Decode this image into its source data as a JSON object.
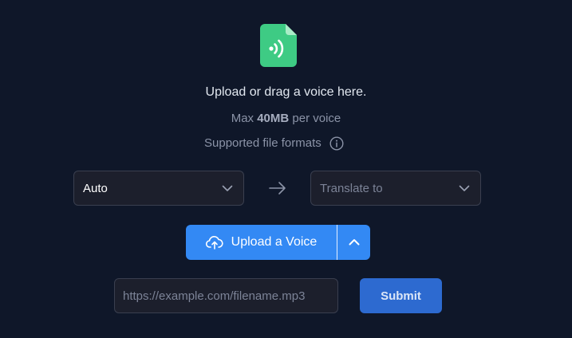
{
  "upload_area": {
    "file_icon": "audio-file-icon",
    "headline": "Upload or drag a voice here.",
    "limit_prefix": "Max ",
    "limit_size": "40MB",
    "limit_suffix": " per voice",
    "formats_label": "Supported file formats",
    "formats_icon": "info-icon"
  },
  "languages": {
    "source_value": "Auto",
    "target_placeholder": "Translate to",
    "arrow_icon": "arrow-right-icon",
    "chevron_icon": "chevron-down-icon"
  },
  "upload_button": {
    "label": "Upload a Voice",
    "icon": "cloud-upload-icon",
    "toggle_icon": "chevron-up-icon"
  },
  "url_form": {
    "placeholder": "https://example.com/filename.mp3",
    "value": "",
    "submit_label": "Submit"
  },
  "colors": {
    "background": "#0f1729",
    "accent": "#3389f4",
    "file_icon": "#3ecb84",
    "submit": "#2d6ad0"
  }
}
